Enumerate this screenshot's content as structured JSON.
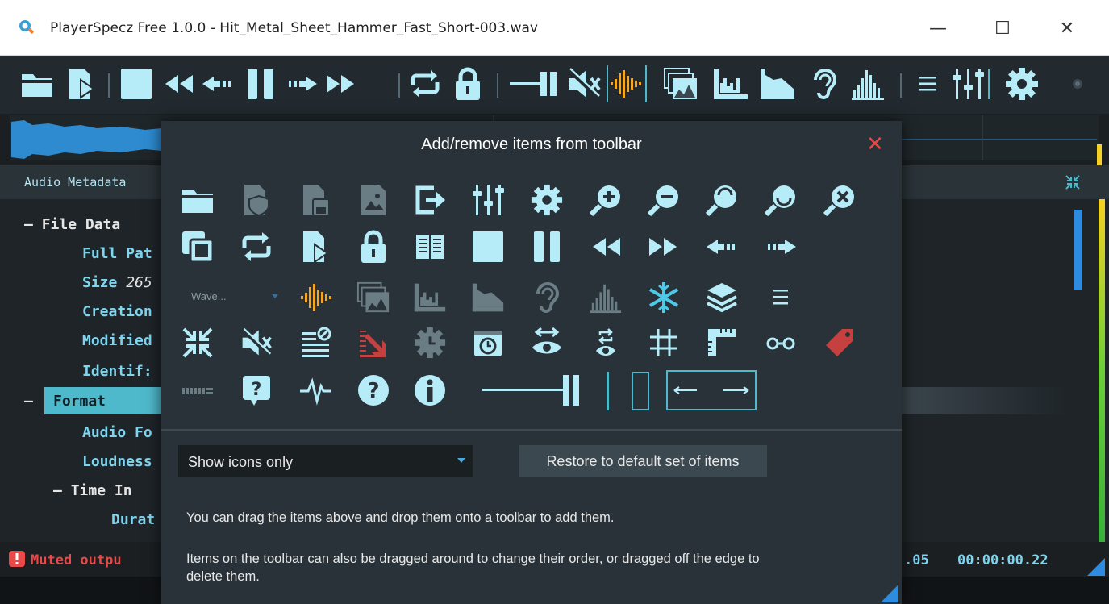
{
  "window": {
    "title": "PlayerSpecz Free 1.0.0 - Hit_Metal_Sheet_Hammer_Fast_Short-003.wav",
    "minimize": "—",
    "maximize": "☐",
    "close": "✕"
  },
  "toolbar": {
    "icons": [
      "open-folder",
      "open-file-play",
      "stop",
      "rewind",
      "seek-back",
      "pause",
      "seek-forward",
      "fast-forward",
      "loop",
      "lock",
      "volume-slider",
      "mute",
      "waveform-color",
      "spectrogram-stack",
      "spectrum-view",
      "area-view",
      "ear",
      "histogram",
      "menu",
      "mixer",
      "settings",
      "record-dot"
    ]
  },
  "metadata_panel": {
    "title": "Audio Metadata",
    "collapse_icon": "collapse-arrows"
  },
  "tree": {
    "file_data": "File Data",
    "full_path": "Full Pat",
    "size_label": "Size",
    "size_value": "265",
    "creation": "Creation",
    "modified": "Modified",
    "identifier": "Identif:",
    "format": "Format",
    "audio_format": "Audio Fo",
    "loudness": "Loudness",
    "time_info": "Time In",
    "duration": "Durat",
    "collapse_marker": "—"
  },
  "status": {
    "message": "Muted outpu",
    "position": ".05",
    "duration": "00:00:00.22"
  },
  "dialog": {
    "title": "Add/remove items from toolbar",
    "close": "✕",
    "wave_combo_text": "Wave...",
    "display_mode": "Show icons only",
    "restore_button": "Restore to default set of items",
    "help_line1": "You can drag the items above and drop them onto a toolbar to add them.",
    "help_line2a": "Items on the toolbar can also be dragged around to change their order, or dragged off the edge to",
    "help_line2b": "delete them.",
    "icons": [
      "folder",
      "file-shield",
      "file-save",
      "image-file",
      "export",
      "mixer",
      "settings",
      "zoom-in",
      "zoom-out",
      "zoom-top",
      "zoom-bottom",
      "zoom-reset",
      "layer-copy",
      "loop",
      "file-play",
      "lock",
      "book",
      "stop",
      "pause",
      "rewind",
      "fast-forward",
      "seek-back",
      "seek-forward",
      "waveform-color",
      "spectrogram-stack",
      "spectrum-view",
      "area-view",
      "ear",
      "histogram",
      "snowflake",
      "layers",
      "menu",
      "collapse",
      "mute",
      "list-filter",
      "download-red",
      "clock-gear",
      "timer-window",
      "eye-swap",
      "eye-loop",
      "grid",
      "ruler",
      "glasses",
      "tag",
      "numbers-bar",
      "help-bubble",
      "pulse",
      "question",
      "info",
      "volume-slider",
      "vertical-line",
      "vertical-box",
      "horizontal-range"
    ]
  },
  "colors": {
    "accent": "#b6ecf7",
    "highlight": "#4fb9cc",
    "waveform_orange": "#f5a623",
    "error_red": "#e84a4a",
    "link_blue": "#2d8be0"
  }
}
